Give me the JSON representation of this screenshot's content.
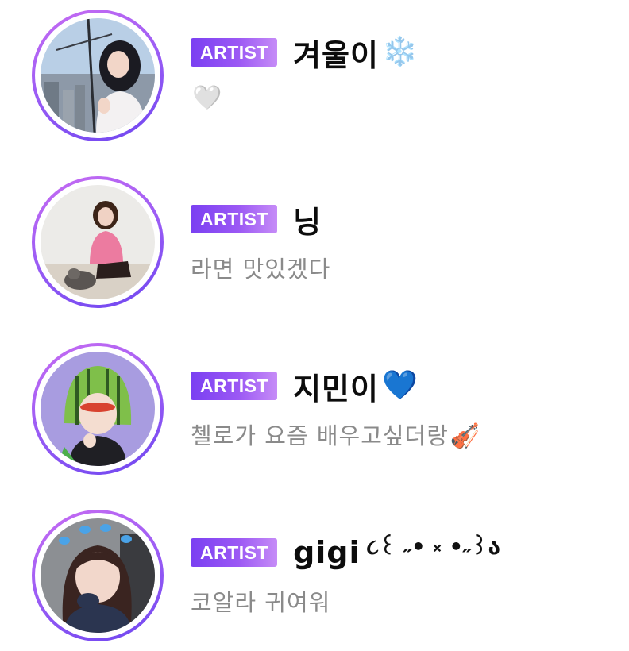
{
  "rows": [
    {
      "badge": "ARTIST",
      "name": "겨울이",
      "name_emoji": "❄️",
      "name_emoji_icon": "snowflake-icon",
      "status": "",
      "status_emoji": "🤍",
      "status_emoji_icon": "white-heart-icon",
      "avatar_icon": "profile-photo"
    },
    {
      "badge": "ARTIST",
      "name": "닝",
      "name_emoji": "",
      "status": "라면 맛있겠다",
      "status_emoji": "",
      "avatar_icon": "profile-photo"
    },
    {
      "badge": "ARTIST",
      "name": "지민이",
      "name_emoji": "💙",
      "name_emoji_icon": "blue-heart-icon",
      "status": "첼로가 요즘 배우고싶더랑",
      "status_emoji": "🎻",
      "status_emoji_icon": "violin-icon",
      "avatar_icon": "profile-photo"
    },
    {
      "badge": "ARTIST",
      "name": "gigi",
      "name_emoji": "૮꒰ ˶• ༝ •˶꒱ა",
      "name_emoji_icon": "kaomoji-face-icon",
      "status": "코알라 귀여워",
      "status_emoji": "",
      "avatar_icon": "profile-photo"
    }
  ],
  "colors": {
    "badge_start": "#7a40f2",
    "badge_end": "#c68cf7",
    "ring_start": "#c86cf2",
    "ring_end": "#6e46f0",
    "name_text": "#0c0c0c",
    "status_text": "#8a8a8a"
  }
}
